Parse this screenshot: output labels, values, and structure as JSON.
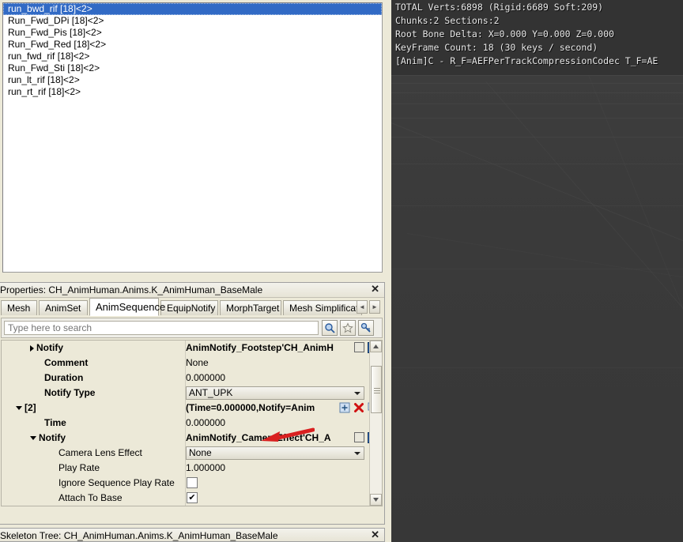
{
  "anim_list": {
    "items": [
      {
        "label": "run_bwd_rif [18]<2>",
        "selected": true
      },
      {
        "label": "Run_Fwd_DPi [18]<2>",
        "selected": false
      },
      {
        "label": "Run_Fwd_Pis [18]<2>",
        "selected": false
      },
      {
        "label": "Run_Fwd_Red [18]<2>",
        "selected": false
      },
      {
        "label": "run_fwd_rif [18]<2>",
        "selected": false
      },
      {
        "label": "Run_Fwd_Sti [18]<2>",
        "selected": false
      },
      {
        "label": "run_lt_rif [18]<2>",
        "selected": false
      },
      {
        "label": "run_rt_rif [18]<2>",
        "selected": false
      }
    ],
    "selection_color": "#316ac5"
  },
  "properties_window": {
    "title": "Properties: CH_AnimHuman.Anims.K_AnimHuman_BaseMale",
    "close_label": "✕",
    "tabs": [
      {
        "label": "Mesh",
        "active": false
      },
      {
        "label": "AnimSet",
        "active": false
      },
      {
        "label": "AnimSequence",
        "active": true
      },
      {
        "label": "EquipNotify",
        "active": false
      },
      {
        "label": "MorphTarget",
        "active": false
      },
      {
        "label": "Mesh Simplificatio",
        "active": false
      }
    ],
    "tab_nav": {
      "prev": "◄",
      "next": "►"
    },
    "search": {
      "placeholder": "Type here to search",
      "value": "",
      "buttons": [
        {
          "name": "search-icon",
          "glyph": "⌕"
        },
        {
          "name": "favorite-star-icon",
          "glyph": "☆"
        },
        {
          "name": "settings-wrench-icon",
          "glyph": "⚒"
        }
      ]
    },
    "rows": [
      {
        "name": "Notify",
        "indent": 2,
        "bold": true,
        "expander": "right",
        "value_type": "object",
        "value": "AnimNotify_Footstep'CH_AnimH"
      },
      {
        "name": "Comment",
        "indent": 3,
        "bold": true,
        "expander": "none",
        "value_type": "text",
        "value": "None"
      },
      {
        "name": "Duration",
        "indent": 3,
        "bold": true,
        "expander": "none",
        "value_type": "spinner",
        "value": "0.000000"
      },
      {
        "name": "Notify Type",
        "indent": 3,
        "bold": true,
        "expander": "none",
        "value_type": "combo",
        "value": "ANT_UPK"
      },
      {
        "name": "[2]",
        "indent": 1,
        "bold": true,
        "expander": "down",
        "value_type": "struct",
        "value": "(Time=0.000000,Notify=Anim"
      },
      {
        "name": "Time",
        "indent": 3,
        "bold": true,
        "expander": "none",
        "value_type": "spinner",
        "value": "0.000000"
      },
      {
        "name": "Notify",
        "indent": 2,
        "bold": true,
        "expander": "down",
        "value_type": "object",
        "value": "AnimNotify_CameraEffect'CH_A"
      },
      {
        "name": "Camera Lens Effect",
        "indent": 4,
        "bold": false,
        "expander": "none",
        "value_type": "combo",
        "value": "None"
      },
      {
        "name": "Play Rate",
        "indent": 4,
        "bold": false,
        "expander": "none",
        "value_type": "spinner",
        "value": "1.000000"
      },
      {
        "name": "Ignore Sequence Play Rate",
        "indent": 4,
        "bold": false,
        "expander": "none",
        "value_type": "checkbox",
        "checked": false,
        "value": ""
      },
      {
        "name": "Attach To Base",
        "indent": 4,
        "bold": false,
        "expander": "none",
        "value_type": "checkbox",
        "checked": true,
        "value": "✔"
      },
      {
        "name": "",
        "indent": 4,
        "bold": false,
        "expander": "none",
        "value_type": "checkbox",
        "checked": false,
        "value": ""
      }
    ]
  },
  "status_bar": {
    "text": "Skeleton Tree: CH_AnimHuman.Anims.K_AnimHuman_BaseMale",
    "close_label": "✕"
  },
  "viewport": {
    "stats": [
      "TOTAL Verts:6898 (Rigid:6689 Soft:209)",
      "Chunks:2 Sections:2",
      "Root Bone Delta: X=0.000 Y=0.000 Z=0.000",
      "KeyFrame Count: 18 (30 keys / second)",
      "[Anim]C - R_F=AEFPerTrackCompressionCodec T_F=AE"
    ],
    "background_color": "#3a3a3a",
    "grid_color": "#4d4d4d",
    "character_colors": {
      "armor_blue": "#3f3f96",
      "armor_light": "#c9c9c9",
      "armor_dark": "#1f1f55",
      "accent": "#5757c8"
    }
  },
  "annotation": {
    "arrow_color": "#d92020",
    "points_at": "AnimNotify_CameraEffect'CH_A"
  }
}
